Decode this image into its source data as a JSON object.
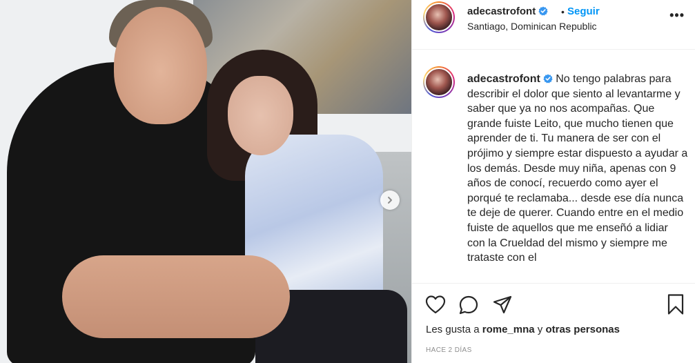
{
  "post": {
    "username": "adecastrofont",
    "follow_label": "Seguir",
    "separator": "•",
    "location": "Santiago, Dominican Republic",
    "more_label": "•••",
    "caption_username": "adecastrofont",
    "caption_text": "No tengo palabras para describir el dolor que siento al levantarme y saber que ya no nos acompañas. Que grande fuiste Leito, que mucho tienen que aprender de ti. Tu manera de ser con el prójimo y siempre estar dispuesto a ayudar a los demás. Desde muy niña, apenas con 9 años de conocí, recuerdo como ayer el porqué te reclamaba... desde ese día nunca te deje de querer. Cuando entre en el medio fuiste de aquellos que me enseñó a lidiar con la Crueldad del mismo y siempre me trataste con el",
    "likes_prefix": "Les gusta a",
    "likes_user": "rome_mna",
    "likes_conj": "y",
    "likes_others": "otras personas",
    "timestamp": "HACE 2 DÍAS"
  },
  "icons": {
    "like": "heart-icon",
    "comment": "comment-icon",
    "share": "send-icon",
    "save": "bookmark-icon",
    "next": "chevron-right-icon",
    "verified": "verified-badge-icon"
  },
  "colors": {
    "accent": "#0095f6",
    "verified": "#3897f0",
    "text": "#262626",
    "muted": "#8e8e8e"
  }
}
